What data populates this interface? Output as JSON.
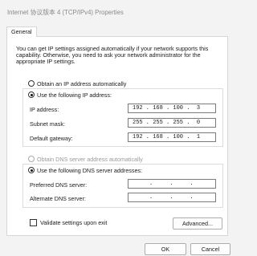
{
  "window": {
    "title": "Internet 协议版本 4 (TCP/IPv4) Properties"
  },
  "tabs": [
    {
      "label": "General"
    }
  ],
  "description": "You can get IP settings assigned automatically if your network supports this capability. Otherwise, you need to ask your network administrator for the appropriate IP settings.",
  "ip_mode": {
    "auto_label": "Obtain an IP address automatically",
    "manual_label": "Use the following IP address:",
    "selected": "manual"
  },
  "ip_fields": {
    "ip_label": "IP address:",
    "ip_value": "192 . 168 . 100 .  3",
    "mask_label": "Subnet mask:",
    "mask_value": "255 . 255 . 255 .  0",
    "gateway_label": "Default gateway:",
    "gateway_value": "192 . 168 . 100 .  1"
  },
  "dns_mode": {
    "auto_label": "Obtain DNS server address automatically",
    "manual_label": "Use the following DNS server addresses:",
    "selected": "manual"
  },
  "dns_fields": {
    "preferred_label": "Preferred DNS server:",
    "preferred_value": "     .     .     .",
    "alternate_label": "Alternate DNS server:",
    "alternate_value": "     .     .     ."
  },
  "validate": {
    "label": "Validate settings upon exit",
    "checked": false
  },
  "buttons": {
    "advanced": "Advanced...",
    "ok": "OK",
    "cancel": "Cancel"
  }
}
